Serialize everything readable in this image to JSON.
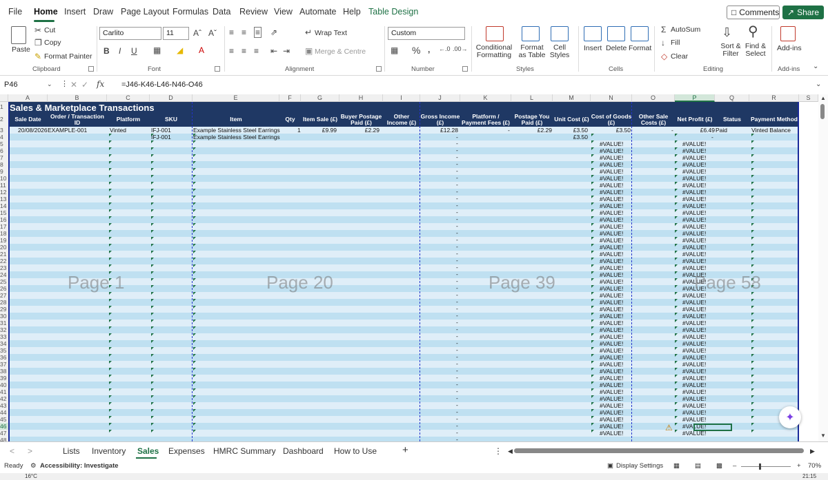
{
  "menu": {
    "tabs": [
      "File",
      "Home",
      "Insert",
      "Draw",
      "Page Layout",
      "Formulas",
      "Data",
      "Review",
      "View",
      "Automate",
      "Help",
      "Table Design"
    ],
    "comments_label": "Comments",
    "share_label": "Share"
  },
  "ribbon": {
    "paste_label": "Paste",
    "cut_label": "Cut",
    "copy_label": "Copy",
    "format_painter_label": "Format Painter",
    "clipboard_label": "Clipboard",
    "font_name": "Carlito",
    "font_size": "11",
    "font_label": "Font",
    "wrap_text_label": "Wrap Text",
    "merge_centre_label": "Merge & Centre",
    "alignment_label": "Alignment",
    "number_format": "Custom",
    "number_label": "Number",
    "conditional_formatting_label": "Conditional Formatting",
    "format_as_table_label": "Format as Table",
    "cell_styles_label": "Cell Styles",
    "styles_label": "Styles",
    "insert_label": "Insert",
    "delete_label": "Delete",
    "format_label": "Format",
    "cells_label": "Cells",
    "autosum_label": "AutoSum",
    "fill_label": "Fill",
    "clear_label": "Clear",
    "sort_filter_label": "Sort & Filter",
    "find_select_label": "Find & Select",
    "editing_label": "Editing",
    "addins_label": "Add-ins",
    "addins_group_label": "Add-ins"
  },
  "formula_bar": {
    "name_box": "P46",
    "fx_label": "fx",
    "formula": "=J46-K46-L46-N46-O46"
  },
  "grid": {
    "columns": [
      "A",
      "B",
      "C",
      "D",
      "E",
      "F",
      "G",
      "H",
      "I",
      "J",
      "K",
      "L",
      "M",
      "N",
      "O",
      "P",
      "Q",
      "R",
      "S"
    ],
    "rows": [
      "1",
      "2",
      "3",
      "4",
      "5",
      "6",
      "7",
      "8",
      "9",
      "10",
      "11",
      "12",
      "13",
      "14",
      "15",
      "16",
      "17",
      "18",
      "19",
      "20",
      "21",
      "22",
      "23",
      "24",
      "25",
      "26",
      "27",
      "28",
      "29",
      "30",
      "31",
      "32",
      "33",
      "34",
      "35",
      "36",
      "37",
      "38",
      "39",
      "40",
      "41",
      "42",
      "43",
      "44",
      "45",
      "46",
      "47",
      "48"
    ],
    "sheet_title": "Sales & Marketplace Transactions",
    "headers": [
      "Sale Date",
      "Order / Transaction ID",
      "Platform",
      "SKU",
      "Item",
      "Qty",
      "Item Sale (£)",
      "Buyer Postage Paid (£)",
      "Other Income (£)",
      "Gross Income (£)",
      "Platform / Payment Fees (£)",
      "Postage You Paid (£)",
      "Unit Cost (£)",
      "Cost of Goods (£)",
      "Other Sale Costs (£)",
      "Net Profit (£)",
      "Status",
      "Payment Method"
    ],
    "row3": {
      "sale_date": "20/08/2026",
      "order_id": "EXAMPLE-001",
      "platform": "Vinted",
      "sku": "IFJ-001",
      "item": "Example Stainless Steel Earrings",
      "qty": "1",
      "item_sale": "£9.99",
      "buyer_postage": "£2.29",
      "gross_income": "£12.28",
      "fees": "-",
      "postage_paid": "£2.29",
      "unit_cost": "£3.50",
      "cost_of_goods": "£3.50",
      "other_costs": "-",
      "net_profit": "£6.49",
      "status": "Paid",
      "payment_method": "Vinted Balance"
    },
    "row4": {
      "sku": "IFJ-001",
      "item": "Example Stainless Steel Earrings",
      "gross_income": "-",
      "unit_cost": "£3.50",
      "net_profit": "-"
    },
    "dash_value": "-",
    "error_value": "#VALUE!",
    "page_marks": [
      "Page 1",
      "Page 20",
      "Page 39",
      "Page 58"
    ]
  },
  "sheet_tabs": [
    "Lists",
    "Inventory",
    "Sales",
    "Expenses",
    "HMRC Summary",
    "Dashboard",
    "How to Use"
  ],
  "active_sheet": "Sales",
  "status": {
    "ready": "Ready",
    "accessibility": "Accessibility: Investigate",
    "display_settings": "Display Settings",
    "zoom": "70%",
    "temperature": "16°C",
    "time": "21:15"
  },
  "colors": {
    "accent": "#1e7145",
    "header_navy": "#1f3864",
    "band_light": "#dfeef8",
    "band_dark": "#bfe0f1",
    "page_break": "#2233cc"
  }
}
